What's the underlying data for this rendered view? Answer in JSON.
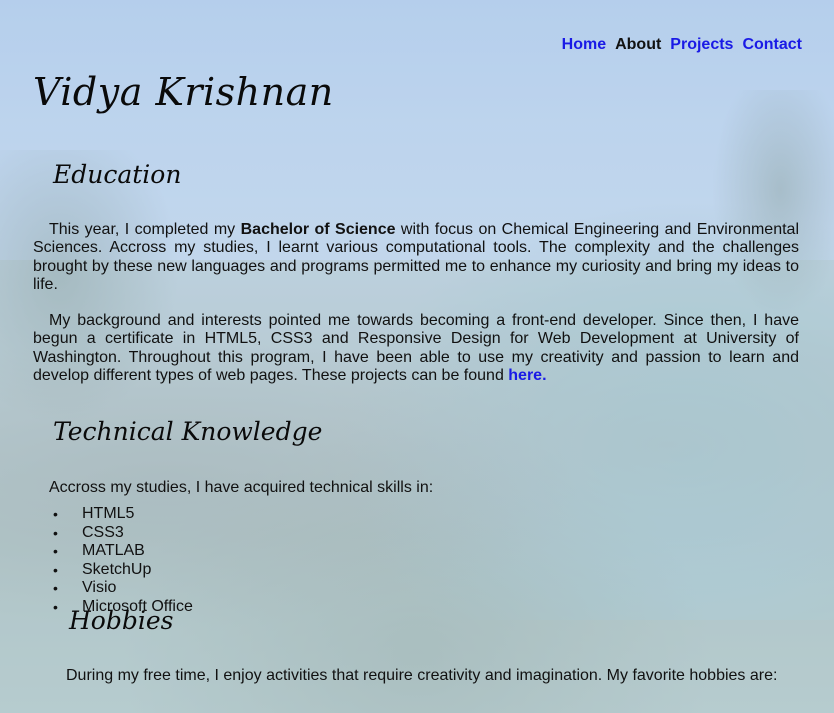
{
  "nav": {
    "items": [
      {
        "label": "Home",
        "current": false
      },
      {
        "label": "About",
        "current": true
      },
      {
        "label": "Projects",
        "current": false
      },
      {
        "label": "Contact",
        "current": false
      }
    ]
  },
  "site_title": "Vidya Krishnan",
  "education": {
    "heading": "Education",
    "para1": {
      "before": "This year, I completed my ",
      "bold": "Bachelor of Science",
      "after": " with focus on Chemical Engineering and Environmental Sciences. Accross my studies, I learnt various computational tools. The complexity and the challenges brought by these new languages and programs permitted me to enhance my curiosity and bring my ideas to life."
    },
    "para2": {
      "text": "My background and interests pointed me towards becoming a front-end developer. Since then, I have begun a certificate in HTML5, CSS3 and Responsive Design for Web Development at University of Washington. Throughout this program, I have been able to use my creativity and passion to learn and develop different types of web pages. These projects can be found ",
      "link": "here."
    }
  },
  "technical": {
    "heading": "Technical Knowledge",
    "intro": "Accross my studies, I have acquired technical skills in:",
    "skills": [
      "HTML5",
      "CSS3",
      "MATLAB",
      "SketchUp",
      "Visio",
      "Microsoft Office"
    ]
  },
  "hobbies": {
    "heading": "Hobbies",
    "intro": "During my free time, I enjoy activities that require creativity and imagination. My favorite hobbies are:"
  },
  "colors": {
    "link": "#1a1ae6",
    "text": "#111111"
  }
}
